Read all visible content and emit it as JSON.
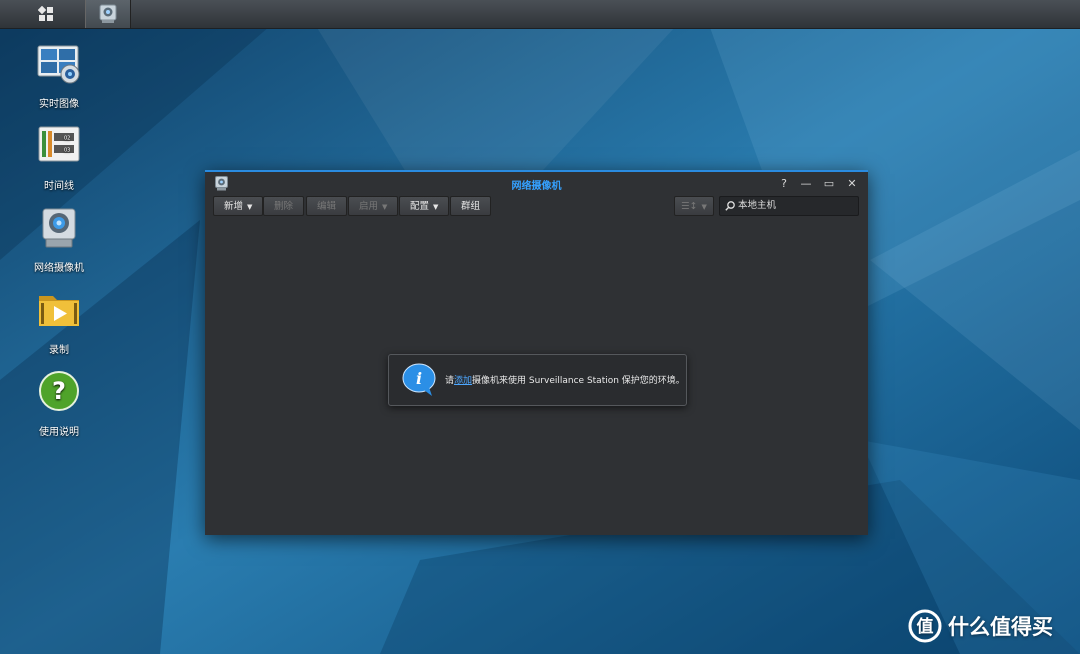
{
  "colors": {
    "accent": "#2a8be0",
    "title": "#35a1ff",
    "window_bg": "#2f3134",
    "desktop": "#1a5b86"
  },
  "taskbar": {
    "items": [
      {
        "icon": "main-menu-icon"
      },
      {
        "icon": "surveillance-app-icon"
      }
    ]
  },
  "desktop": {
    "icons": [
      {
        "label": "实时图像",
        "icon": "live-view-icon"
      },
      {
        "label": "时间线",
        "icon": "timeline-icon"
      },
      {
        "label": "网络摄像机",
        "icon": "ip-camera-icon"
      },
      {
        "label": "录制",
        "icon": "recording-folder-icon"
      },
      {
        "label": "使用说明",
        "icon": "help-icon"
      }
    ]
  },
  "window": {
    "title": "网络摄像机",
    "controls": {
      "help": "?",
      "minimize": "—",
      "maximize": "▭",
      "close": "✕"
    },
    "toolbar": {
      "add": "新增",
      "delete": "删除",
      "edit": "编辑",
      "enable": "启用",
      "configure": "配置",
      "group": "群组"
    },
    "search": {
      "placeholder": "本地主机"
    },
    "message": {
      "prefix": "请",
      "link": "添加",
      "suffix": "摄像机来使用 Surveillance Station 保护您的环境。"
    }
  },
  "watermark": {
    "text": "什么值得买"
  }
}
